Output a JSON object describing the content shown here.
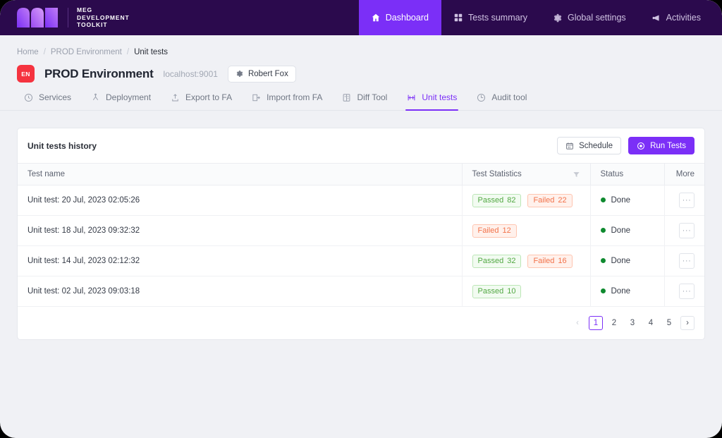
{
  "brand": {
    "name_lines": "MEG\nDEVELOPMENT\nTOOLKIT",
    "logo_icon": "meg-logo-icon"
  },
  "topnav": {
    "items": [
      {
        "label": "Dashboard",
        "icon": "home-icon",
        "active": true
      },
      {
        "label": "Tests summary",
        "icon": "grid-icon",
        "active": false
      },
      {
        "label": "Global settings",
        "icon": "gear-icon",
        "active": false
      },
      {
        "label": "Activities",
        "icon": "megaphone-icon",
        "active": false
      }
    ]
  },
  "breadcrumb": {
    "items": [
      {
        "label": "Home",
        "current": false
      },
      {
        "label": "PROD Environment",
        "current": false
      },
      {
        "label": "Unit tests",
        "current": true
      }
    ],
    "separator": "/"
  },
  "page_header": {
    "env_badge": "EN",
    "title": "PROD Environment",
    "host": "localhost:9001",
    "user_chip": {
      "label": "Robert Fox",
      "icon": "gear-icon"
    }
  },
  "subtabs": [
    {
      "label": "Services",
      "icon": "clock-icon",
      "active": false
    },
    {
      "label": "Deployment",
      "icon": "sitemap-icon",
      "active": false
    },
    {
      "label": "Export to FA",
      "icon": "export-icon",
      "active": false
    },
    {
      "label": "Import from FA",
      "icon": "import-icon",
      "active": false
    },
    {
      "label": "Diff Tool",
      "icon": "diff-icon",
      "active": false
    },
    {
      "label": "Unit tests",
      "icon": "unit-tests-icon",
      "active": true
    },
    {
      "label": "Audit tool",
      "icon": "audit-icon",
      "active": false
    }
  ],
  "card": {
    "title": "Unit tests history",
    "schedule_button": {
      "label": "Schedule",
      "icon": "calendar-icon"
    },
    "run_button": {
      "label": "Run Tests",
      "icon": "play-circle-icon",
      "color": "#7b2ff7"
    }
  },
  "table": {
    "columns": {
      "name": "Test name",
      "stats": "Test Statistics",
      "status": "Status",
      "more": "More"
    },
    "stats_filter_icon": "filter-icon",
    "more_label": "···",
    "rows": [
      {
        "name": "Unit test: 20 Jul, 2023 02:05:26",
        "passed_label": "Passed",
        "passed_count": "82",
        "failed_label": "Failed",
        "failed_count": "22",
        "status": "Done"
      },
      {
        "name": "Unit test: 18 Jul, 2023 09:32:32",
        "passed_label": "",
        "passed_count": "",
        "failed_label": "Failed",
        "failed_count": "12",
        "status": "Done"
      },
      {
        "name": "Unit test: 14 Jul, 2023 02:12:32",
        "passed_label": "Passed",
        "passed_count": "32",
        "failed_label": "Failed",
        "failed_count": "16",
        "status": "Done"
      },
      {
        "name": "Unit test: 02 Jul, 2023 09:03:18",
        "passed_label": "Passed",
        "passed_count": "10",
        "failed_label": "",
        "failed_count": "",
        "status": "Done"
      }
    ]
  },
  "pagination": {
    "prev": "‹",
    "next": "›",
    "pages": [
      "1",
      "2",
      "3",
      "4",
      "5"
    ],
    "active_page": "1"
  },
  "colors": {
    "header_bg": "#2b0a4d",
    "accent": "#7b2ff7",
    "page_bg": "#f0f1f5",
    "passed": "#52a843",
    "failed": "#f2724a",
    "status_dot": "#0f8a2f",
    "env_badge": "#f5333f"
  }
}
